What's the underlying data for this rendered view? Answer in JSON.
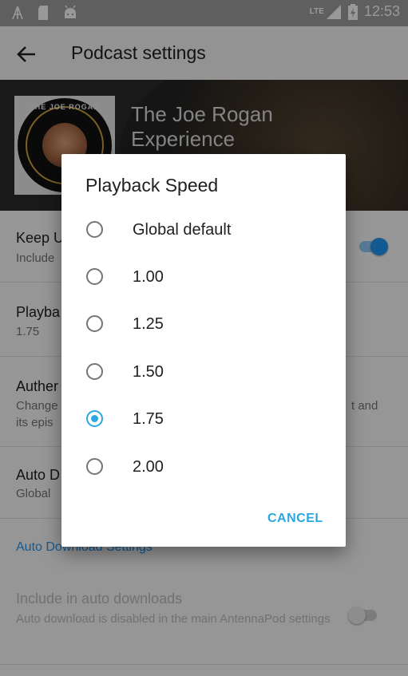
{
  "status_bar": {
    "time": "12:53",
    "network": "LTE",
    "icons": [
      "antenna-icon",
      "sd-card-icon",
      "android-icon",
      "signal-icon",
      "battery-charging-icon"
    ]
  },
  "app_bar": {
    "back_icon": "arrow-back-icon",
    "title": "Podcast settings"
  },
  "podcast": {
    "title": "The Joe Rogan Experience",
    "cover_text": "THE JOE ROGAN"
  },
  "settings": {
    "keep_updated": {
      "title": "Keep U",
      "subtitle": "Include",
      "enabled": true
    },
    "playback": {
      "title": "Playba",
      "value": "1.75"
    },
    "auth": {
      "title": "Auther",
      "subtitle_line1": "Change",
      "subtitle_line1_tail": "t and",
      "subtitle_line2": "its epis"
    },
    "auto_delete": {
      "title": "Auto D",
      "subtitle": "Global"
    },
    "auto_download_header": "Auto Download Settings",
    "include_auto": {
      "title": "Include in auto downloads",
      "subtitle": "Auto download is disabled in the main AntennaPod settings",
      "enabled": false
    }
  },
  "dialog": {
    "title": "Playback Speed",
    "options": [
      {
        "label": "Global default",
        "selected": false
      },
      {
        "label": "1.00",
        "selected": false
      },
      {
        "label": "1.25",
        "selected": false
      },
      {
        "label": "1.50",
        "selected": false
      },
      {
        "label": "1.75",
        "selected": true
      },
      {
        "label": "2.00",
        "selected": false
      }
    ],
    "cancel_label": "CANCEL"
  },
  "colors": {
    "accent": "#2ba7e2",
    "switch_on": "#2196f3"
  }
}
